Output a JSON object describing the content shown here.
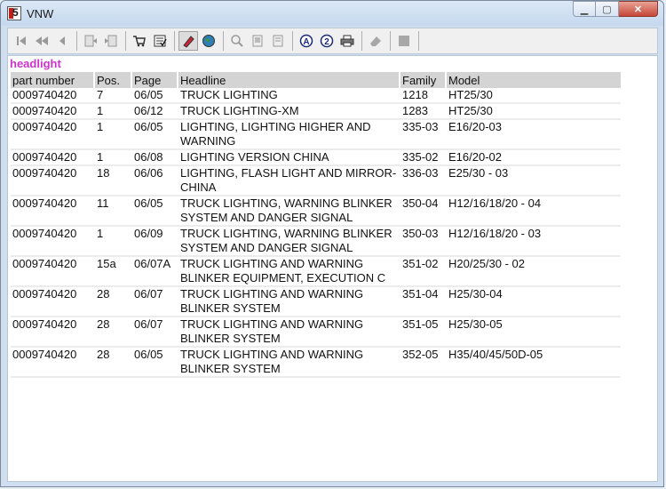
{
  "window": {
    "title": "VNW"
  },
  "toolbar": {
    "icons": [
      "first-page-icon",
      "previous-fast-icon",
      "previous-icon",
      "back-document-icon",
      "forward-document-icon",
      "cart-icon",
      "checklist-icon",
      "marker-icon",
      "globe-icon",
      "zoom-icon",
      "page-icon",
      "page-alt-icon",
      "a-circle-icon",
      "two-circle-icon",
      "print-icon",
      "eraser-icon",
      "stop-icon"
    ]
  },
  "section_title": "headlight",
  "table": {
    "headers": [
      "part number",
      "Pos.",
      "Page",
      "Headline",
      "Family",
      "Model"
    ],
    "rows": [
      {
        "part": "0009740420",
        "pos": "7",
        "page": "06/05",
        "headline": "TRUCK LIGHTING",
        "suffix": "",
        "family": "1218",
        "model": "HT25/30"
      },
      {
        "part": "0009740420",
        "pos": "1",
        "page": "06/12",
        "headline": "TRUCK LIGHTING",
        "suffix": "-XM",
        "family": "1283",
        "model": "HT25/30"
      },
      {
        "part": "0009740420",
        "pos": "1",
        "page": "06/05",
        "headline": "LIGHTING, LIGHTING HIGHER AND WARNING",
        "suffix": "",
        "family": "335-03",
        "model": "E16/20-03"
      },
      {
        "part": "0009740420",
        "pos": "1",
        "page": "06/08",
        "headline": "LIGHTING VERSION CHINA",
        "suffix": "",
        "family": "335-02",
        "model": "E16/20-02"
      },
      {
        "part": "0009740420",
        "pos": "18",
        "page": "06/06",
        "headline": "LIGHTING, FLASH LIGHT AND MIRROR-",
        "suffix": "CHINA",
        "family": "336-03",
        "model": "E25/30 - 03"
      },
      {
        "part": "0009740420",
        "pos": "11",
        "page": "06/05",
        "headline": "TRUCK LIGHTING, WARNING BLINKER SYSTEM AND DANGER SIGNAL",
        "suffix": "",
        "family": "350-04",
        "model": "H12/16/18/20 - 04"
      },
      {
        "part": "0009740420",
        "pos": "1",
        "page": "06/09",
        "headline": "TRUCK LIGHTING, WARNING BLINKER SYSTEM AND DANGER SIGNAL",
        "suffix": "",
        "family": "350-03",
        "model": "H12/16/18/20 - 03"
      },
      {
        "part": "0009740420",
        "pos": "15a",
        "page": "06/07A",
        "headline": "TRUCK LIGHTING AND WARNING BLINKER EQUIPMENT, EXECUTION C",
        "suffix": "",
        "family": "351-02",
        "model": "H20/25/30 - 02"
      },
      {
        "part": "0009740420",
        "pos": "28",
        "page": "06/07",
        "headline": "TRUCK LIGHTING AND WARNING BLINKER SYSTEM",
        "suffix": "",
        "family": "351-04",
        "model": "H25/30-04"
      },
      {
        "part": "0009740420",
        "pos": "28",
        "page": "06/07",
        "headline": "TRUCK LIGHTING AND WARNING BLINKER SYSTEM",
        "suffix": "",
        "family": "351-05",
        "model": "H25/30-05"
      },
      {
        "part": "0009740420",
        "pos": "28",
        "page": "06/05",
        "headline": "TRUCK LIGHTING AND WARNING BLINKER SYSTEM",
        "suffix": "",
        "family": "352-05",
        "model": "H35/40/45/50D-05"
      }
    ]
  }
}
